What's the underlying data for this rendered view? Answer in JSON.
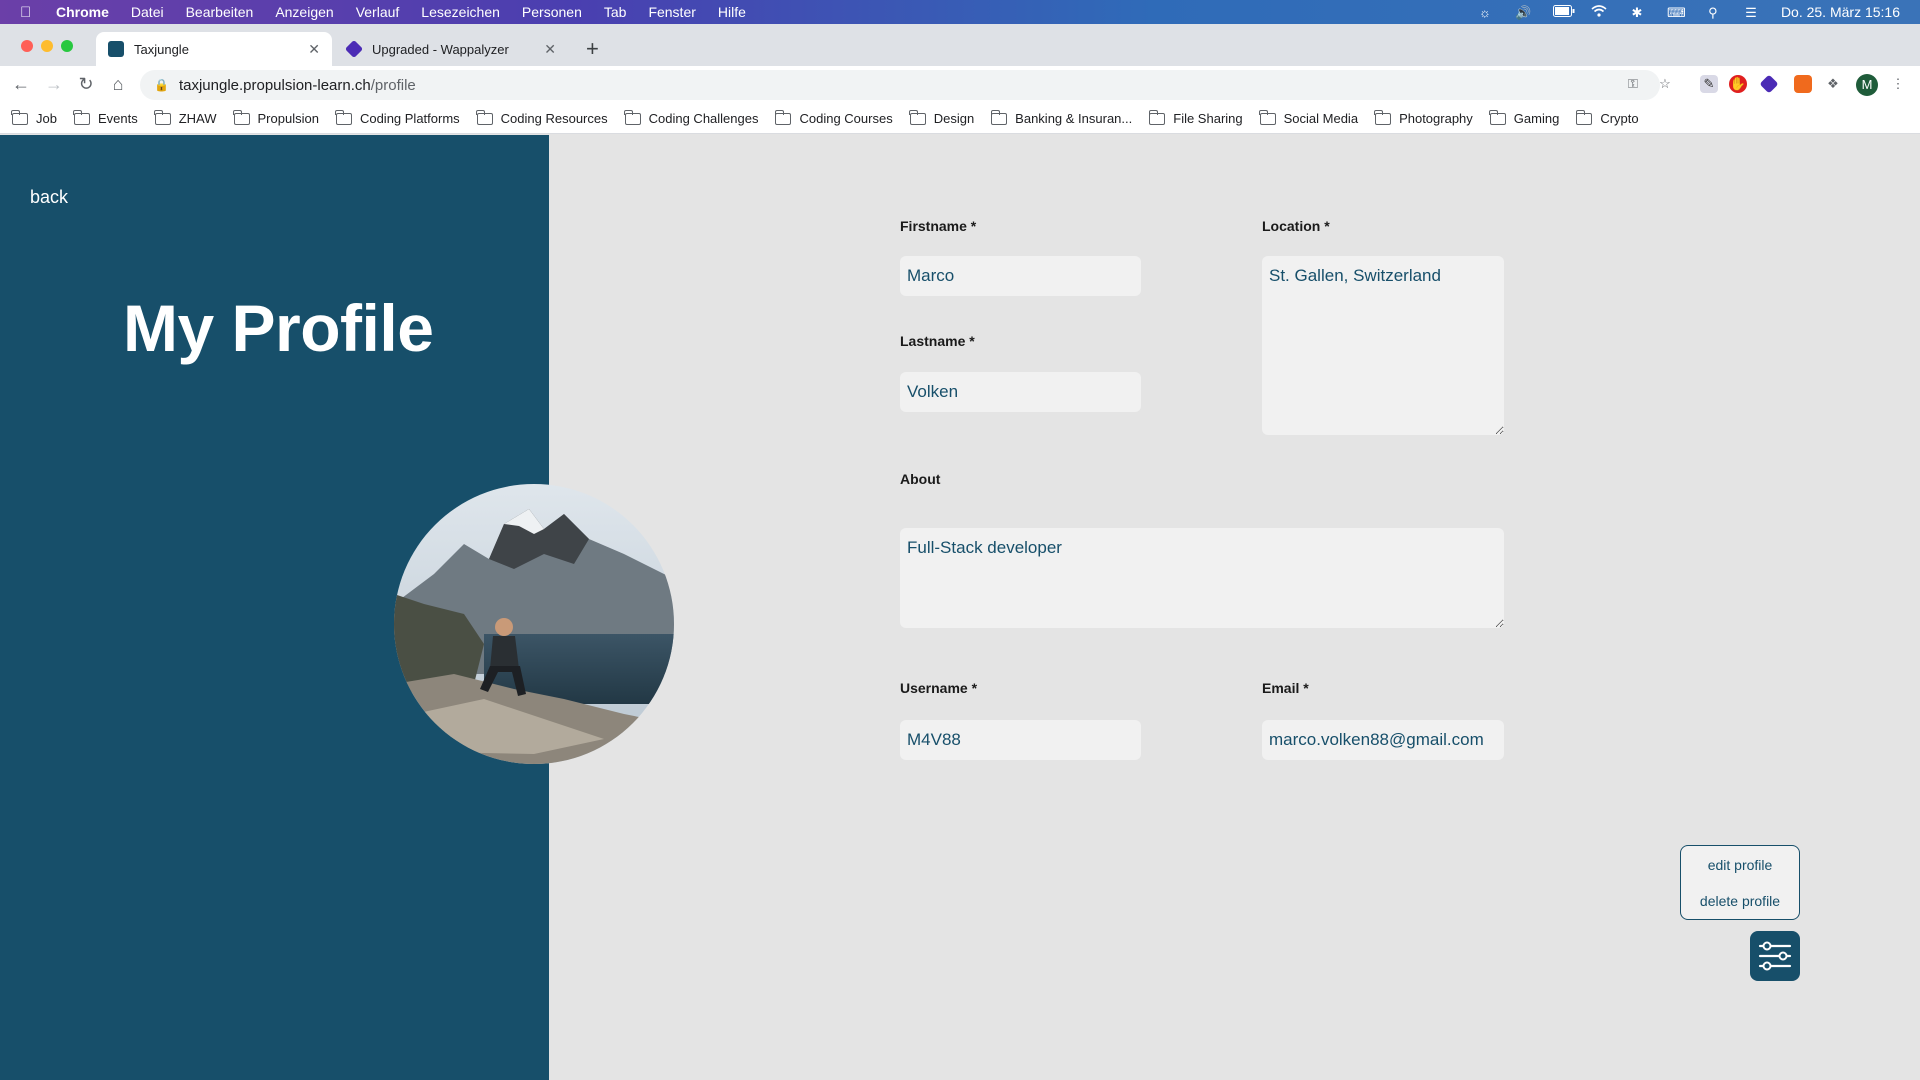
{
  "menubar": {
    "app": "Chrome",
    "items": [
      "Datei",
      "Bearbeiten",
      "Anzeigen",
      "Verlauf",
      "Lesezeichen",
      "Personen",
      "Tab",
      "Fenster",
      "Hilfe"
    ],
    "clock": "Do. 25. März  15:16"
  },
  "tabs": [
    {
      "title": "Taxjungle",
      "active": true
    },
    {
      "title": "Upgraded - Wappalyzer",
      "active": false
    }
  ],
  "toolbar": {
    "url_host": "taxjungle.propulsion-learn.ch",
    "url_path": "/profile",
    "profile_initial": "M"
  },
  "bookmarks": [
    "Job",
    "Events",
    "ZHAW",
    "Propulsion",
    "Coding Platforms",
    "Coding Resources",
    "Coding Challenges",
    "Coding Courses",
    "Design",
    "Banking & Insuran...",
    "File Sharing",
    "Social Media",
    "Photography",
    "Gaming",
    "Crypto"
  ],
  "profile": {
    "back_label": "back",
    "title": "My Profile",
    "firstname_label": "Firstname *",
    "firstname_value": "Marco",
    "lastname_label": "Lastname *",
    "lastname_value": "Volken",
    "location_label": "Location *",
    "location_value": "St. Gallen, Switzerland",
    "about_label": "About",
    "about_value": "Full-Stack developer",
    "username_label": "Username *",
    "username_value": "M4V88",
    "email_label": "Email *",
    "email_value": "marco.volken88@gmail.com"
  },
  "actions": {
    "edit_label": "edit profile",
    "delete_label": "delete profile"
  },
  "colors": {
    "primary": "#174f6a",
    "page_bg": "#e4e4e4",
    "field_bg": "#f1f1f1"
  }
}
